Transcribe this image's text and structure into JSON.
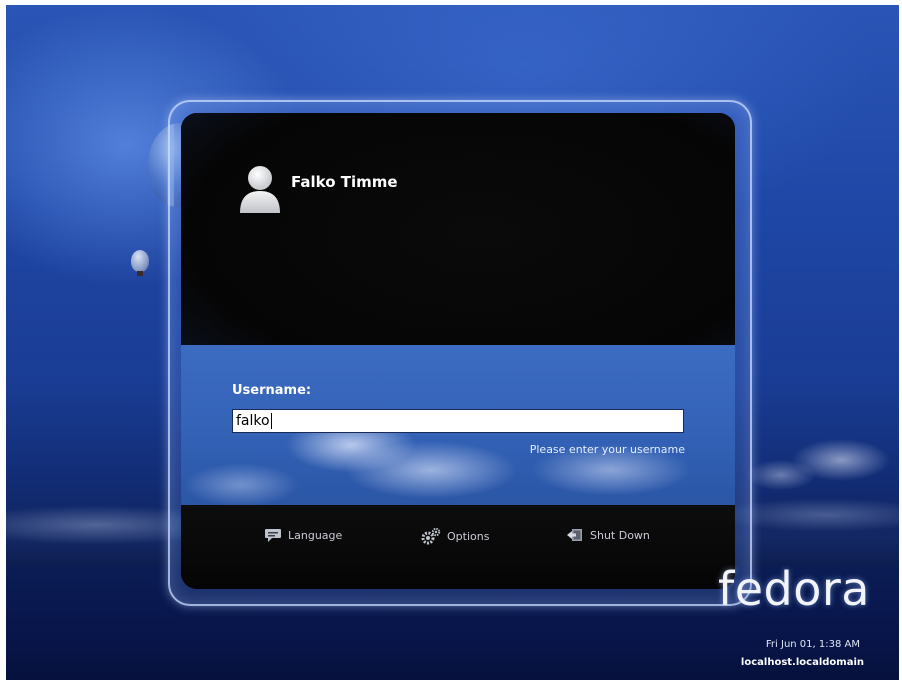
{
  "login": {
    "user_name": "Falko Timme",
    "username_label": "Username:",
    "username_value": "falko",
    "username_hint": "Please enter your username"
  },
  "actions": {
    "language_label": "Language",
    "options_label": "Options",
    "shutdown_label": "Shut Down"
  },
  "branding": {
    "logo_text": "fedora",
    "datetime": "Fri Jun 01,  1:38 AM",
    "hostname": "localhost.localdomain"
  },
  "icons": {
    "avatar": "user-avatar-icon",
    "language": "speech-bubble-icon",
    "options": "gears-icon",
    "shutdown": "shutdown-icon"
  },
  "colors": {
    "background": "#1f47a6",
    "panel": "#050505",
    "input_area": "#3463b8",
    "text": "#ffffff"
  }
}
